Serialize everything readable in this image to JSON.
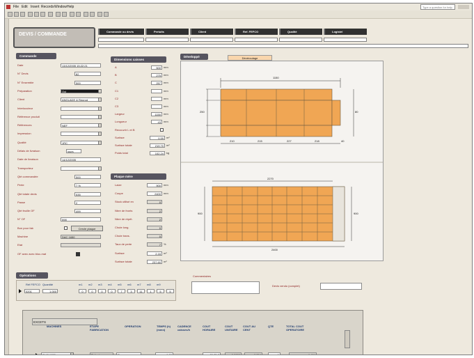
{
  "menu": [
    "File",
    "Edit",
    "Insert",
    "Records",
    "Window",
    "Help"
  ],
  "help_placeholder": "Type a question for help",
  "title": "DEVIS / COMMANDE",
  "nav_tabs": [
    "Commande ou devis",
    "Pertuits",
    "Client",
    "Ref. FEFCO",
    "Qualité",
    "Logistel"
  ],
  "sections": {
    "commande": "Commande",
    "dimensions": "Dimensions caisses",
    "developpe": "Développé",
    "plaque": "Plaque mère",
    "operations": "Opérations"
  },
  "developpe_tab": "Dévéroulage",
  "commande_fields": [
    {
      "label": "Date",
      "value": "13/12/2005 15:22:21"
    },
    {
      "label": "N° Devis",
      "value": "82"
    },
    {
      "label": "N° Ensemble",
      "value": "500"
    },
    {
      "label": "Préparation",
      "value": "Oui"
    },
    {
      "label": "Client",
      "value": "ANGLADE & Reprod"
    },
    {
      "label": "Interlocuteur",
      "value": ""
    },
    {
      "label": "Référence produit",
      "value": ""
    },
    {
      "label": "Références",
      "value": "NEF"
    },
    {
      "label": "Impression",
      "value": ""
    },
    {
      "label": "Qualité",
      "value": "1RC"
    },
    {
      "label": "Délais de livraison",
      "value": "jours"
    },
    {
      "label": "Date de livraison",
      "value": "14/12/2005"
    },
    {
      "label": "Transporteur",
      "value": ""
    },
    {
      "label": "Qté commandée",
      "value": "500"
    },
    {
      "label": "Perte",
      "value": "7 %"
    },
    {
      "label": "Qté totale devis",
      "value": "535"
    },
    {
      "label": "Passe",
      "value": "2"
    },
    {
      "label": "Qté feuille OF",
      "value": "499"
    },
    {
      "label": "N° OF",
      "value": "598"
    },
    {
      "label": "Bon pour fab",
      "value": ""
    },
    {
      "label": "Machine",
      "value": "DAC 1650"
    },
    {
      "label": "Etat",
      "value": ""
    },
    {
      "label": "OF avec avec bloc-mat",
      "value": ""
    }
  ],
  "bon_button": "Cercle plaque",
  "dimension_fields": [
    {
      "label": "A",
      "value": "500",
      "unit": "mm"
    },
    {
      "label": "B",
      "value": "275",
      "unit": "mm"
    },
    {
      "label": "C",
      "value": "257",
      "unit": "mm"
    },
    {
      "label": "C1",
      "value": "",
      "unit": "mm"
    },
    {
      "label": "C2",
      "value": "",
      "unit": "mm"
    },
    {
      "label": "C3",
      "value": "",
      "unit": "mm"
    },
    {
      "label": "Largeur",
      "value": "1150",
      "unit": "mm"
    },
    {
      "label": "Longueur",
      "value": "43",
      "unit": "mm"
    },
    {
      "label": "Recouvrir L et B",
      "value": "",
      "unit": ""
    },
    {
      "label": "Surface",
      "value": "0,59",
      "unit": "m²"
    },
    {
      "label": "Surface totale",
      "value": "219,70",
      "unit": "m²"
    },
    {
      "label": "Poids total",
      "value": "102,24",
      "unit": "kg"
    }
  ],
  "plaque_fields": [
    {
      "label": "Laize",
      "value": "900",
      "unit": "mm"
    },
    {
      "label": "Coupe",
      "value": "2400",
      "unit": "mm"
    },
    {
      "label": "Stock utilisé en",
      "value": "0",
      "unit": ""
    },
    {
      "label": "Nbre de fronts",
      "value": "2",
      "unit": ""
    },
    {
      "label": "Nbre de répét.",
      "value": "2",
      "unit": ""
    },
    {
      "label": "Chute long.",
      "value": "0",
      "unit": ""
    },
    {
      "label": "Chute trans.",
      "value": "0",
      "unit": ""
    },
    {
      "label": "Taux de perte",
      "value": "7",
      "unit": "%"
    },
    {
      "label": "Surface",
      "value": "2,16",
      "unit": "m²"
    },
    {
      "label": "Surface totale",
      "value": "237,60",
      "unit": "m²"
    }
  ],
  "diagram1": {
    "total": "1150",
    "height": "250",
    "flap": "80",
    "segments": [
      "210",
      "215",
      "227",
      "218",
      "40"
    ]
  },
  "diagram2": {
    "width": "2270",
    "total": "2400",
    "height": "900",
    "side": "900"
  },
  "commentaires_label": "Commentaires",
  "vente_label": "Devis vendu (complet)",
  "operations_header": [
    "Réf FEFCO",
    "Quantité",
    "m1",
    "m2",
    "m3",
    "m4",
    "m5",
    "m6",
    "m7",
    "m8",
    "m9"
  ],
  "operations_row": {
    "ref": "0201",
    "qty": "1,000",
    "cells": [
      "0",
      "0",
      "0",
      "0",
      "7",
      "3",
      "11",
      "1",
      "5",
      "5"
    ]
  },
  "machine_group": "EXCETS",
  "machine_header": [
    "MACHINES",
    "ETAPE FABRICATION",
    "OPERATION",
    "TEMPS (h) (mmn)",
    "CADENCE caisses/h",
    "COUT HORAIRE",
    "COUT UNITAIRE",
    "COUT AU CENT",
    "QTE",
    "TOTAL COUT OPERATOIRE"
  ],
  "machine_row": {
    "machine": "SLIC 1650",
    "etape": "Refente",
    "operation": "Rogage",
    "temps": "1.00",
    "cout_horaire": "29,25 €",
    "cout_unitaire": "0,0000",
    "cout_cent": "0,264",
    "qte": "1",
    "total": "1,464"
  },
  "colors": {
    "orange": "#f0a654",
    "section": "#56545f",
    "label": "#8b1c1c",
    "window": "#eee9de"
  }
}
